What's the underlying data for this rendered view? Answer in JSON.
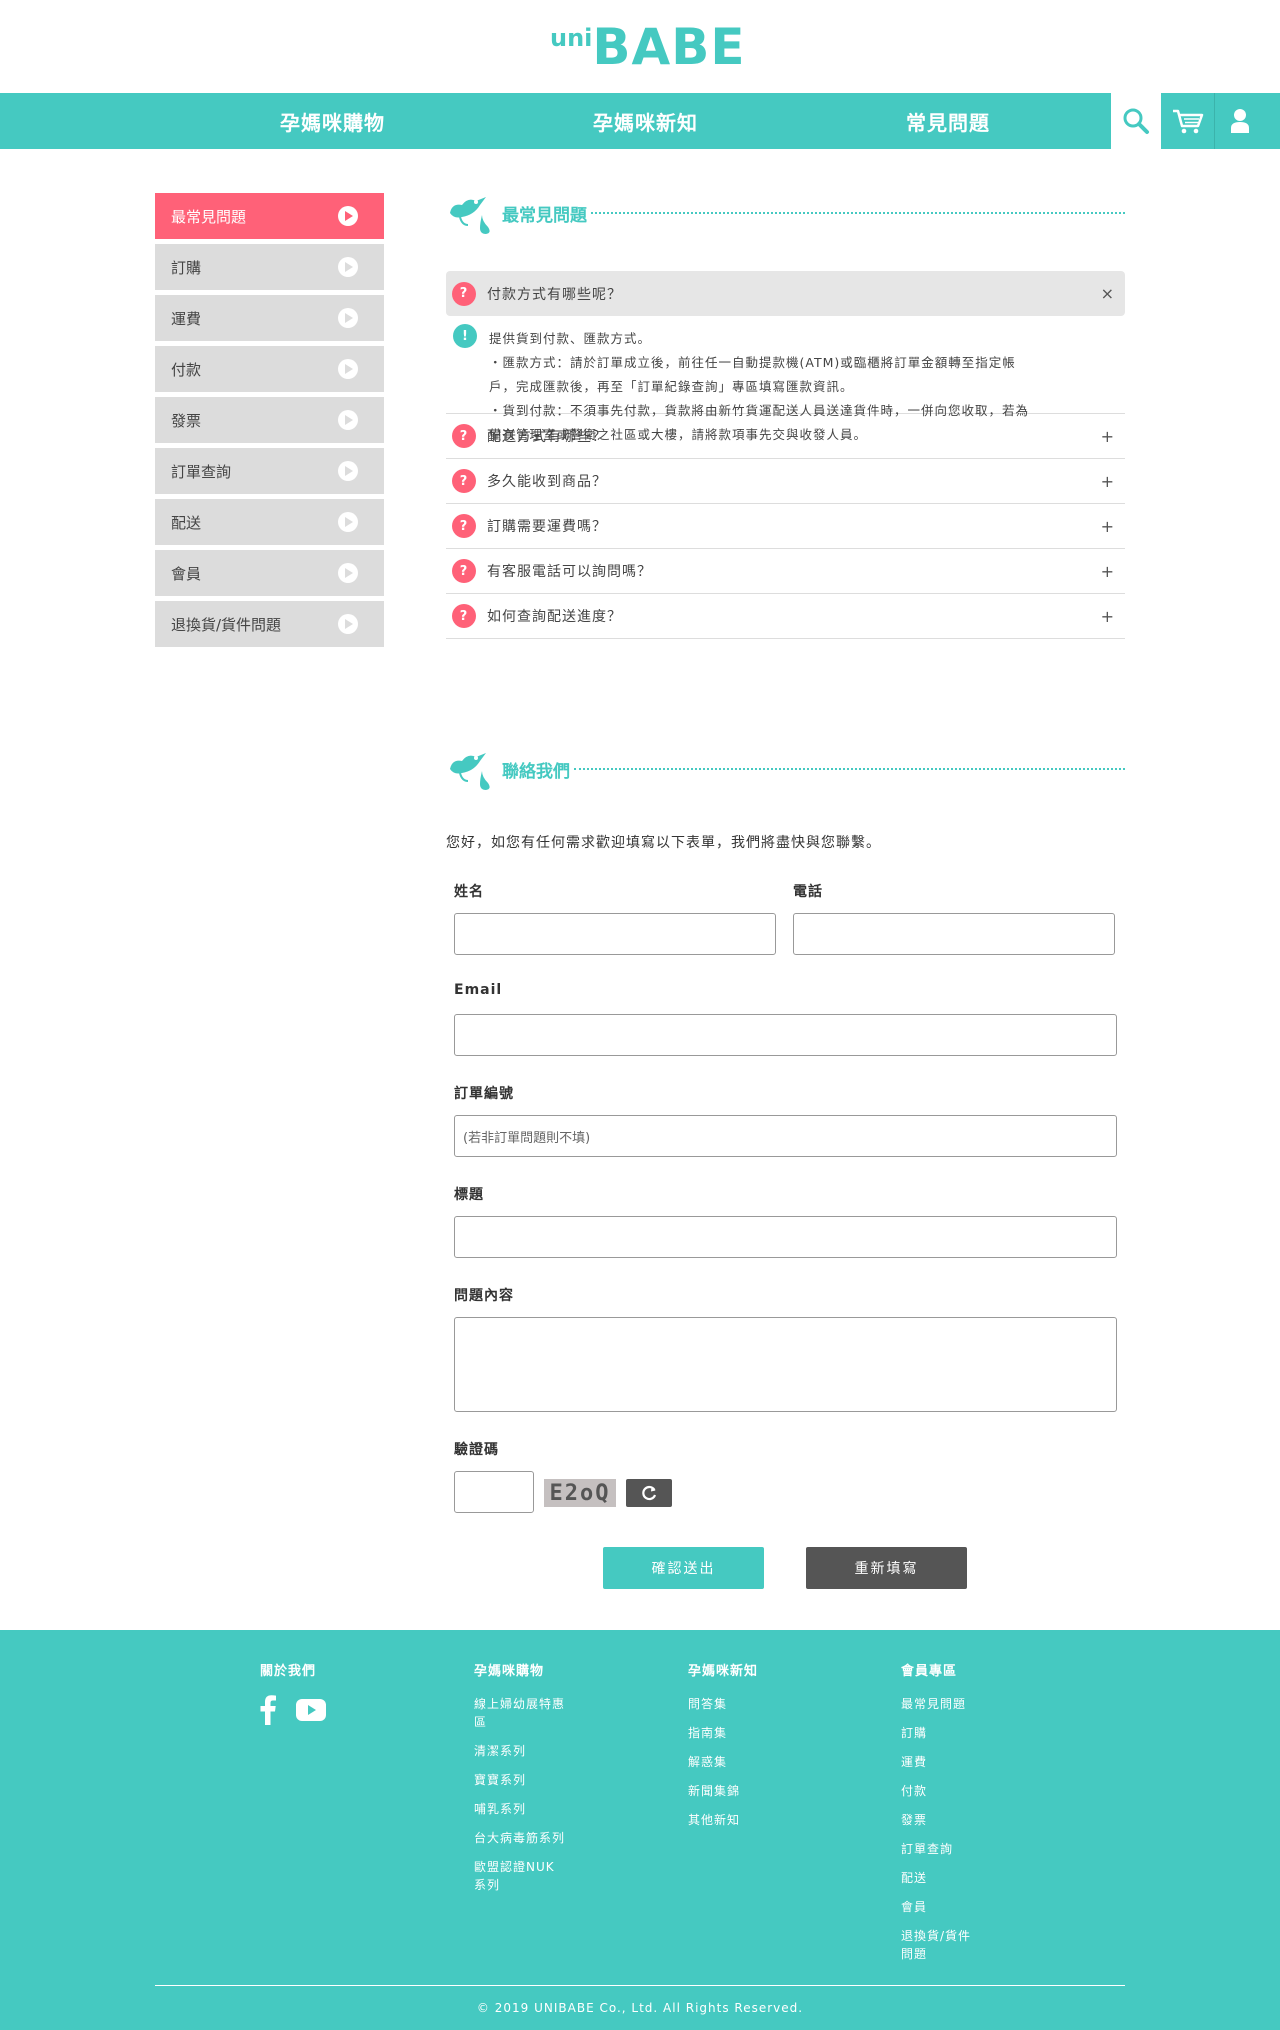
{
  "header": {
    "logo_prefix": "uni",
    "logo_main": "BABE",
    "nav": [
      "孕媽咪購物",
      "孕媽咪新知",
      "常見問題"
    ]
  },
  "sidebar": {
    "items": [
      {
        "label": "最常見問題",
        "active": true
      },
      {
        "label": "訂購"
      },
      {
        "label": "運費"
      },
      {
        "label": "付款"
      },
      {
        "label": "發票"
      },
      {
        "label": "訂單查詢"
      },
      {
        "label": "配送"
      },
      {
        "label": "會員"
      },
      {
        "label": "退換貨/貨件問題"
      }
    ]
  },
  "faq": {
    "title": "最常見問題",
    "q_mark": "?",
    "a_mark": "!",
    "open": {
      "question": "付款方式有哪些呢？",
      "toggle": "×",
      "answer_lines": [
        "提供貨到付款、匯款方式。",
        "・匯款方式：請於訂單成立後，前往任一自動提款機(ATM)或臨櫃將訂單金額轉至指定帳",
        "戶，完成匯款後，再至「訂單紀錄查詢」專區填寫匯款資訊。",
        "・貨到付款：不須事先付款，貨款將由新竹貨運配送人員送達貨件時，一併向您收取，若為",
        "備有管理室或警衛之社區或大樓，請將款項事先交與收發人員。"
      ]
    },
    "items": [
      {
        "question": "配送方式有哪些？",
        "toggle": "+"
      },
      {
        "question": "多久能收到商品？",
        "toggle": "+"
      },
      {
        "question": "訂購需要運費嗎？",
        "toggle": "+"
      },
      {
        "question": "有客服電話可以詢問嗎？",
        "toggle": "+"
      },
      {
        "question": "如何查詢配送進度？",
        "toggle": "+"
      }
    ]
  },
  "contact": {
    "title": "聯絡我們",
    "intro": "您好，如您有任何需求歡迎填寫以下表單，我們將盡快與您聯繫。",
    "name_label": "姓名",
    "phone_label": "電話",
    "email_label": "Email",
    "order_label": "訂單編號",
    "order_placeholder": "(若非訂單問題則不填)",
    "subject_label": "標題",
    "content_label": "問題內容",
    "captcha_label": "驗證碼",
    "captcha_text": "E2oQ",
    "submit_label": "確認送出",
    "reset_label": "重新填寫"
  },
  "footer": {
    "cols": [
      {
        "title": "關於我們",
        "links": []
      },
      {
        "title": "孕媽咪購物",
        "links": [
          "線上婦幼展特惠區",
          "清潔系列",
          "寶寶系列",
          "哺乳系列",
          "台大病毒筋系列",
          "歐盟認證NUK系列"
        ]
      },
      {
        "title": "孕媽咪新知",
        "links": [
          "問答集",
          "指南集",
          "解惑集",
          "新聞集錦",
          "其他新知"
        ]
      },
      {
        "title": "會員專區",
        "links": [
          "最常見問題",
          "訂購",
          "運費",
          "付款",
          "發票",
          "訂單查詢",
          "配送",
          "會員",
          "退換貨/貨件問題"
        ]
      }
    ],
    "copyright": "© 2019 UNIBABE Co., Ltd. All Rights Reserved."
  },
  "colors": {
    "accent": "#45c9c1",
    "pink": "#ff6178",
    "gray_button": "#555555"
  }
}
